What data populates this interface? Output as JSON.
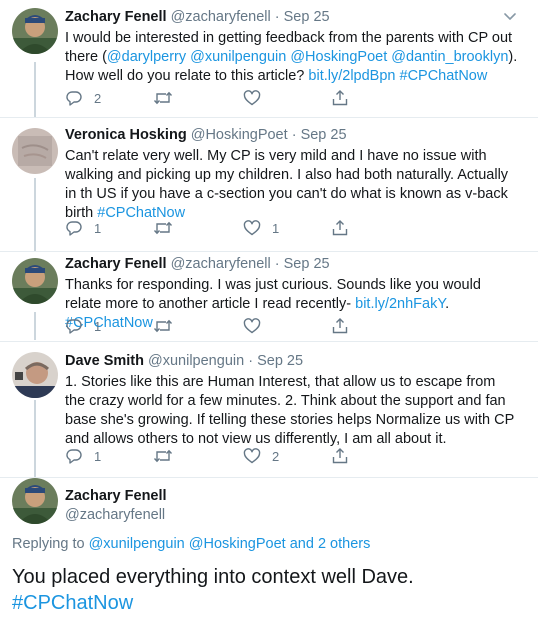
{
  "tweets": [
    {
      "name": "Zachary Fenell",
      "handle": "@zacharyfenell",
      "dot": "·",
      "date": "Sep 25",
      "text_parts": [
        {
          "t": "I would be interested in getting feedback from the parents with CP out there (",
          "link": false
        },
        {
          "t": "@darylperry",
          "link": true
        },
        {
          "t": " ",
          "link": false
        },
        {
          "t": "@xunilpenguin",
          "link": true
        },
        {
          "t": " ",
          "link": false
        },
        {
          "t": "@HoskingPoet",
          "link": true
        },
        {
          "t": " ",
          "link": false
        },
        {
          "t": "@dantin_brooklyn",
          "link": true
        },
        {
          "t": "). How well do you relate to this article? ",
          "link": false
        },
        {
          "t": "bit.ly/2lpdBpn",
          "link": true
        },
        {
          "t": " ",
          "link": false
        },
        {
          "t": "#CPChatNow",
          "link": true
        }
      ],
      "reply_count": "2",
      "retweet_count": "",
      "like_count": ""
    },
    {
      "name": "Veronica Hosking",
      "handle": "@HoskingPoet",
      "dot": "·",
      "date": "Sep 25",
      "text_parts": [
        {
          "t": "Can't relate very well. My CP is very mild and I have no issue with walking and picking up my children. I also had both naturally. Actually in th US if you have a c-section you can't do what is known as v-back birth ",
          "link": false
        },
        {
          "t": "#CPChatNow",
          "link": true
        }
      ],
      "reply_count": "1",
      "retweet_count": "",
      "like_count": "1"
    },
    {
      "name": "Zachary Fenell",
      "handle": "@zacharyfenell",
      "dot": "·",
      "date": "Sep 25",
      "text_parts": [
        {
          "t": "Thanks for responding. I was just curious. Sounds like you would relate more to another article I read recently- ",
          "link": false
        },
        {
          "t": "bit.ly/2nhFakY",
          "link": true
        },
        {
          "t": ". ",
          "link": false
        },
        {
          "t": "#CPChatNow",
          "link": true
        }
      ],
      "reply_count": "1",
      "retweet_count": "",
      "like_count": ""
    },
    {
      "name": "Dave Smith",
      "handle": "@xunilpenguin",
      "dot": "·",
      "date": "Sep 25",
      "text_parts": [
        {
          "t": "1. Stories like this are Human Interest, that allow us to escape from the crazy world for a few minutes.  2. Think about the support and fan base she's growing. If telling these stories helps Normalize us with CP and allows others to not view us differently, I am all about it.",
          "link": false
        }
      ],
      "reply_count": "1",
      "retweet_count": "",
      "like_count": "2"
    }
  ],
  "main_tweet": {
    "name": "Zachary Fenell",
    "handle": "@zacharyfenell",
    "replying_prefix": "Replying to ",
    "replying_parts": [
      {
        "t": "@xunilpenguin",
        "link": true
      },
      {
        "t": " ",
        "link": false
      },
      {
        "t": "@HoskingPoet",
        "link": true
      },
      {
        "t": " and ",
        "link": true
      },
      {
        "t": "2 others",
        "link": true
      }
    ],
    "text": "You placed everything into context well Dave.",
    "hashtag": "#CPChatNow"
  },
  "colors": {
    "link": "#1b95e0",
    "secondary": "#657786",
    "border": "#e6ecf0"
  },
  "icons": [
    "reply-icon",
    "retweet-icon",
    "like-icon",
    "share-icon",
    "chevron-down-icon"
  ]
}
